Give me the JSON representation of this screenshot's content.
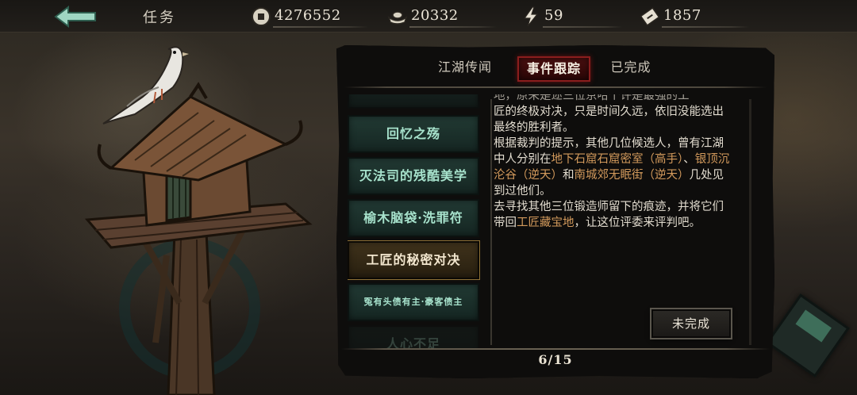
{
  "header": {
    "title": "任务",
    "resources": [
      {
        "icon": "copper-coin-icon",
        "value": "4276552"
      },
      {
        "icon": "silver-ingot-icon",
        "value": "20332"
      },
      {
        "icon": "lightning-icon",
        "value": "59"
      },
      {
        "icon": "ticket-icon",
        "value": "1857"
      }
    ]
  },
  "tabs": [
    {
      "label": "江湖传闻",
      "active": false
    },
    {
      "label": "事件跟踪",
      "active": true
    },
    {
      "label": "已完成",
      "active": false
    }
  ],
  "quests": [
    {
      "label": "回忆之殇",
      "state": "normal"
    },
    {
      "label": "灭法司的残酷美学",
      "state": "normal"
    },
    {
      "label": "榆木脑袋·洗罪符",
      "state": "normal"
    },
    {
      "label": "工匠的秘密对决",
      "state": "selected"
    },
    {
      "label": "冤有头债有主·豪客债主",
      "state": "normal"
    },
    {
      "label": "人心不足",
      "state": "faded"
    }
  ],
  "description": {
    "line_partial": "地，原来是迩三位京哈个许是最强的工",
    "p1": "匠的终极对决，只是时间久远，依旧没能选出最终的胜利者。",
    "p2_a": "根据裁判的提示，其他几位候选人，曾有江湖中人分别在",
    "p2_hl1": "地下石窟石窟密室（高手）",
    "p2_b": "、",
    "p2_hl2": "银顶沉沦谷（逆天）",
    "p2_c": "和",
    "p2_hl3": "南城郊无眠街（逆天）",
    "p2_d": "几处见到过他们。",
    "p3_a": "去寻找其他三位锻造师留下的痕迹，并将它们带回",
    "p3_hl": "工匠藏宝地",
    "p3_b": "，让这位评委来评判吧。"
  },
  "status_button": "未完成",
  "pagination": "6/15",
  "colors": {
    "highlight": "#d39a5c",
    "quest_text": "#a7e2cc",
    "active_tab": "#8a1d1d"
  }
}
